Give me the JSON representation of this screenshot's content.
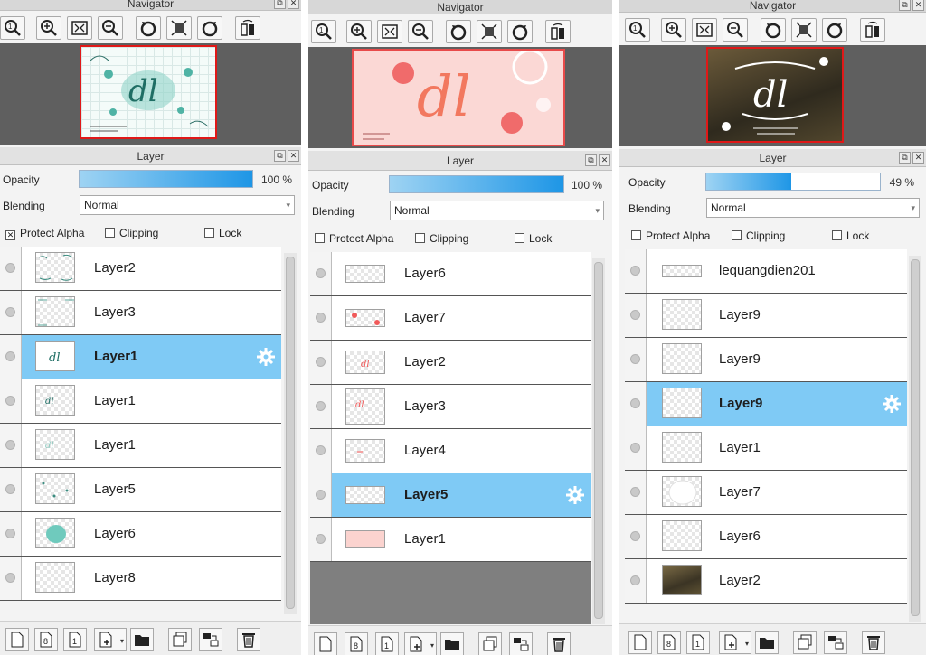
{
  "panels": [
    {
      "navigator": {
        "title": "Navigator"
      },
      "layer_panel": {
        "title": "Layer",
        "opacity_label": "Opacity",
        "opacity_value": "100 %",
        "opacity_fraction": 1.0,
        "blending_label": "Blending",
        "blending_value": "Normal",
        "protect_alpha_label": "Protect Alpha",
        "protect_alpha_checked": true,
        "clipping_label": "Clipping",
        "lock_label": "Lock"
      },
      "layers": [
        {
          "name": "Layer2",
          "selected": false
        },
        {
          "name": "Layer3",
          "selected": false
        },
        {
          "name": "Layer1",
          "selected": true
        },
        {
          "name": "Layer1",
          "selected": false
        },
        {
          "name": "Layer1",
          "selected": false
        },
        {
          "name": "Layer5",
          "selected": false
        },
        {
          "name": "Layer6",
          "selected": false
        },
        {
          "name": "Layer8",
          "selected": false
        }
      ]
    },
    {
      "navigator": {
        "title": "Navigator"
      },
      "layer_panel": {
        "title": "Layer",
        "opacity_label": "Opacity",
        "opacity_value": "100 %",
        "opacity_fraction": 1.0,
        "blending_label": "Blending",
        "blending_value": "Normal",
        "protect_alpha_label": "Protect Alpha",
        "protect_alpha_checked": false,
        "clipping_label": "Clipping",
        "lock_label": "Lock"
      },
      "layers": [
        {
          "name": "Layer6",
          "selected": false
        },
        {
          "name": "Layer7",
          "selected": false
        },
        {
          "name": "Layer2",
          "selected": false
        },
        {
          "name": "Layer3",
          "selected": false
        },
        {
          "name": "Layer4",
          "selected": false
        },
        {
          "name": "Layer5",
          "selected": true
        },
        {
          "name": "Layer1",
          "selected": false
        }
      ]
    },
    {
      "navigator": {
        "title": "Navigator"
      },
      "layer_panel": {
        "title": "Layer",
        "opacity_label": "Opacity",
        "opacity_value": "49 %",
        "opacity_fraction": 0.49,
        "blending_label": "Blending",
        "blending_value": "Normal",
        "protect_alpha_label": "Protect Alpha",
        "protect_alpha_checked": false,
        "clipping_label": "Clipping",
        "lock_label": "Lock"
      },
      "layers": [
        {
          "name": "lequangdien201",
          "selected": false
        },
        {
          "name": "Layer9",
          "selected": false
        },
        {
          "name": "Layer9",
          "selected": false
        },
        {
          "name": "Layer9",
          "selected": true
        },
        {
          "name": "Layer1",
          "selected": false
        },
        {
          "name": "Layer7",
          "selected": false
        },
        {
          "name": "Layer6",
          "selected": false
        },
        {
          "name": "Layer2",
          "selected": false
        }
      ]
    }
  ],
  "icons": {
    "navigator_toolbar": [
      "zoom-fit-icon",
      "zoom-in-icon",
      "fit-screen-icon",
      "zoom-out-icon",
      "rotate-left-icon",
      "actual-size-icon",
      "rotate-right-icon",
      "flip-horizontal-icon"
    ],
    "footer": [
      "new-layer-icon",
      "new-8bit-layer-icon",
      "new-1bit-layer-icon",
      "add-layer-menu-icon",
      "folder-icon",
      "duplicate-layer-icon",
      "merge-down-icon",
      "delete-layer-icon"
    ],
    "header": [
      "float-window-icon",
      "close-icon"
    ]
  },
  "colors": {
    "selected_row": "#7fcaf5",
    "opacity_fill": "#1e96e6",
    "thumbnail_border": "#e01818"
  }
}
